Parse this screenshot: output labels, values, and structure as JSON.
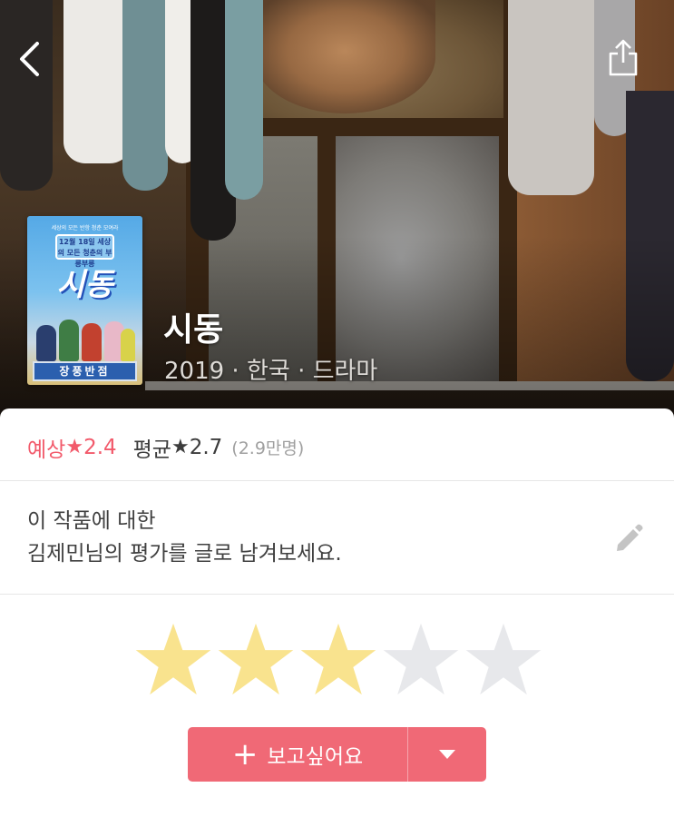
{
  "nav": {
    "back_icon": "chevron-left-icon",
    "share_icon": "share-icon"
  },
  "poster": {
    "subtitle": "세상의 모든 반항 청춘 모여라",
    "tag": "12월 18일 세상의 모든 청춘의 부릉부릉",
    "title": "시동",
    "sign": "장풍반점"
  },
  "movie": {
    "title": "시동",
    "meta": "2019 · 한국 · 드라마"
  },
  "ratings": {
    "expected_label": "예상",
    "expected_value": "2.4",
    "average_label": "평균",
    "average_value": "2.7",
    "count": "(2.9만명)",
    "star_glyph": "★",
    "accent_color": "#f25a6b"
  },
  "review": {
    "line1": "이 작품에 대한",
    "line2": "김제민님의 평가를 글로 남겨보세요.",
    "edit_icon": "pencil-icon"
  },
  "user_rating": {
    "max": 5,
    "filled": 3,
    "filled_color": "#f9e38e",
    "empty_color": "#e7e8eb"
  },
  "wishlist": {
    "plus": "+",
    "label": "보고싶어요",
    "dropdown_icon": "caret-down-icon",
    "color": "#f06976"
  }
}
